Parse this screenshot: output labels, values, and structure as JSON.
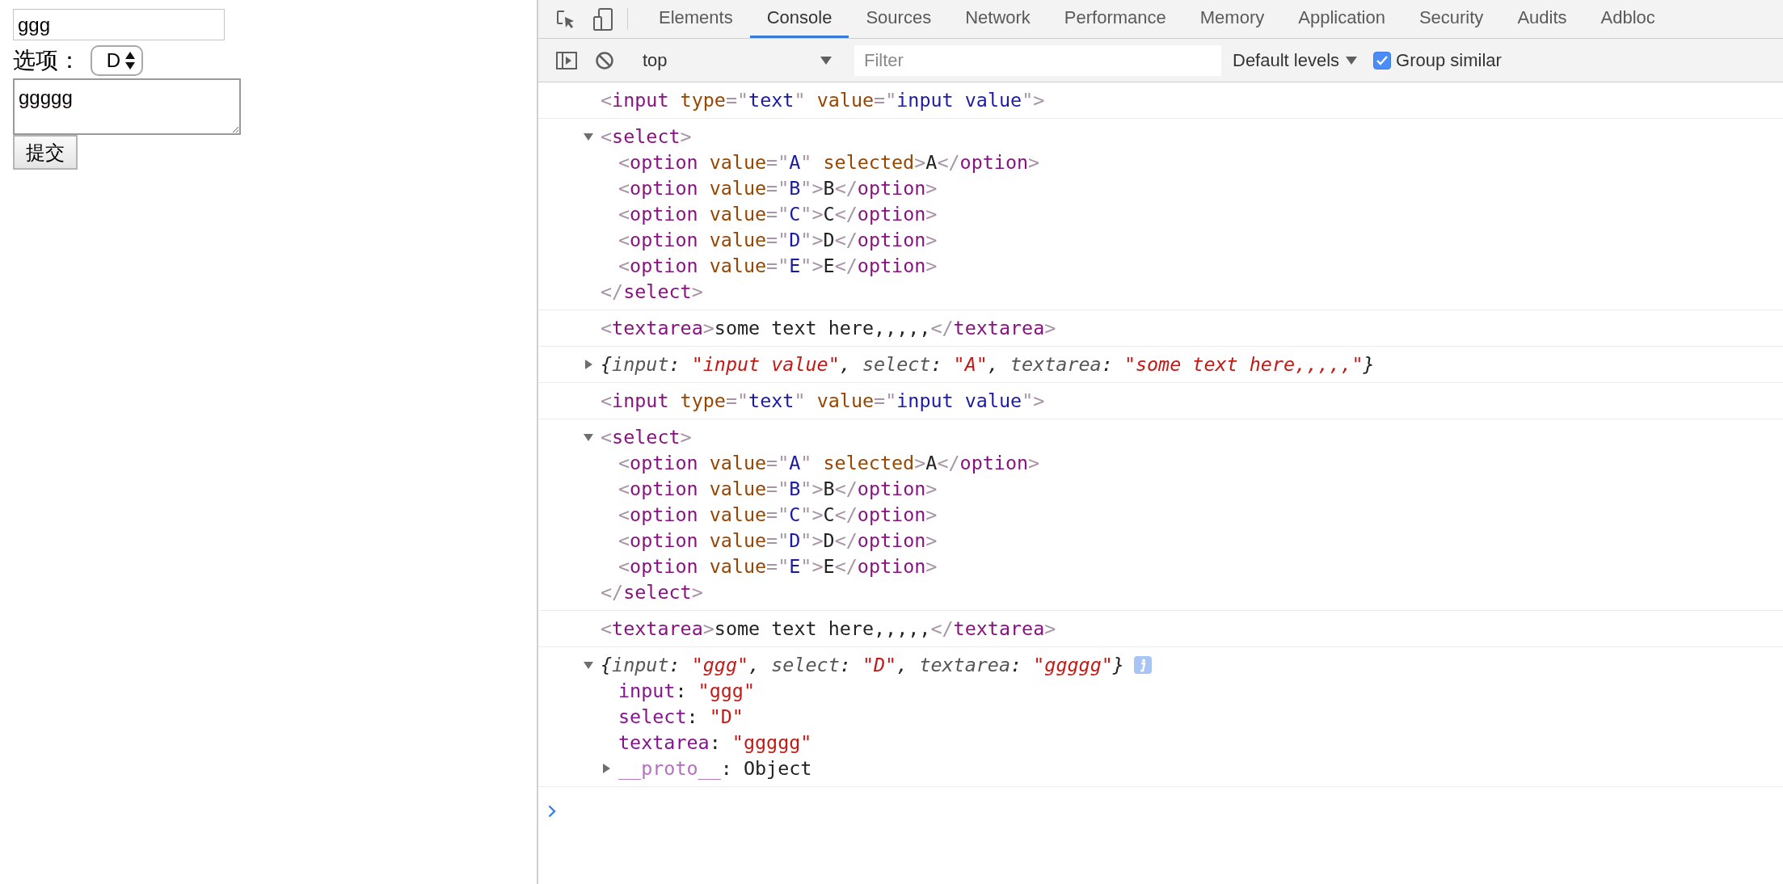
{
  "page_form": {
    "input_value": "ggg",
    "select_label": "选项：",
    "select_value": "D",
    "textarea_value": "ggggg",
    "submit_label": "提交"
  },
  "devtools": {
    "tabs": [
      {
        "label": "Elements",
        "selected": false
      },
      {
        "label": "Console",
        "selected": true
      },
      {
        "label": "Sources",
        "selected": false
      },
      {
        "label": "Network",
        "selected": false
      },
      {
        "label": "Performance",
        "selected": false
      },
      {
        "label": "Memory",
        "selected": false
      },
      {
        "label": "Application",
        "selected": false
      },
      {
        "label": "Security",
        "selected": false
      },
      {
        "label": "Audits",
        "selected": false
      },
      {
        "label": "Adbloc",
        "selected": false
      }
    ],
    "console_toolbar": {
      "context": "top",
      "filter_placeholder": "Filter",
      "levels": "Default levels",
      "group_similar": {
        "label": "Group similar",
        "checked": true
      }
    },
    "messages": [
      {
        "line": [
          {
            "kind": "punct",
            "text": "<"
          },
          {
            "kind": "tag",
            "text": "input"
          },
          {
            "kind": "attr",
            "text": " type"
          },
          {
            "kind": "punct",
            "text": "=\""
          },
          {
            "kind": "value",
            "text": "text"
          },
          {
            "kind": "punct",
            "text": "\""
          },
          {
            "kind": "attr",
            "text": " value"
          },
          {
            "kind": "punct",
            "text": "=\""
          },
          {
            "kind": "value",
            "text": "input value"
          },
          {
            "kind": "punct",
            "text": "\">"
          }
        ]
      },
      {
        "expanded": true,
        "line": [
          {
            "kind": "punct",
            "text": "<"
          },
          {
            "kind": "tag",
            "text": "select"
          },
          {
            "kind": "punct",
            "text": ">"
          }
        ],
        "children": [
          {
            "line": [
              {
                "kind": "punct",
                "text": "<"
              },
              {
                "kind": "tag",
                "text": "option"
              },
              {
                "kind": "attr",
                "text": " value"
              },
              {
                "kind": "punct",
                "text": "=\""
              },
              {
                "kind": "value",
                "text": "A"
              },
              {
                "kind": "punct",
                "text": "\""
              },
              {
                "kind": "attr",
                "text": " selected"
              },
              {
                "kind": "punct",
                "text": ">"
              },
              {
                "kind": "plain",
                "text": "A"
              },
              {
                "kind": "punct",
                "text": "</"
              },
              {
                "kind": "tag",
                "text": "option"
              },
              {
                "kind": "punct",
                "text": ">"
              }
            ]
          },
          {
            "line": [
              {
                "kind": "punct",
                "text": "<"
              },
              {
                "kind": "tag",
                "text": "option"
              },
              {
                "kind": "attr",
                "text": " value"
              },
              {
                "kind": "punct",
                "text": "=\""
              },
              {
                "kind": "value",
                "text": "B"
              },
              {
                "kind": "punct",
                "text": "\">"
              },
              {
                "kind": "plain",
                "text": "B"
              },
              {
                "kind": "punct",
                "text": "</"
              },
              {
                "kind": "tag",
                "text": "option"
              },
              {
                "kind": "punct",
                "text": ">"
              }
            ]
          },
          {
            "line": [
              {
                "kind": "punct",
                "text": "<"
              },
              {
                "kind": "tag",
                "text": "option"
              },
              {
                "kind": "attr",
                "text": " value"
              },
              {
                "kind": "punct",
                "text": "=\""
              },
              {
                "kind": "value",
                "text": "C"
              },
              {
                "kind": "punct",
                "text": "\">"
              },
              {
                "kind": "plain",
                "text": "C"
              },
              {
                "kind": "punct",
                "text": "</"
              },
              {
                "kind": "tag",
                "text": "option"
              },
              {
                "kind": "punct",
                "text": ">"
              }
            ]
          },
          {
            "line": [
              {
                "kind": "punct",
                "text": "<"
              },
              {
                "kind": "tag",
                "text": "option"
              },
              {
                "kind": "attr",
                "text": " value"
              },
              {
                "kind": "punct",
                "text": "=\""
              },
              {
                "kind": "value",
                "text": "D"
              },
              {
                "kind": "punct",
                "text": "\">"
              },
              {
                "kind": "plain",
                "text": "D"
              },
              {
                "kind": "punct",
                "text": "</"
              },
              {
                "kind": "tag",
                "text": "option"
              },
              {
                "kind": "punct",
                "text": ">"
              }
            ]
          },
          {
            "line": [
              {
                "kind": "punct",
                "text": "<"
              },
              {
                "kind": "tag",
                "text": "option"
              },
              {
                "kind": "attr",
                "text": " value"
              },
              {
                "kind": "punct",
                "text": "=\""
              },
              {
                "kind": "value",
                "text": "E"
              },
              {
                "kind": "punct",
                "text": "\">"
              },
              {
                "kind": "plain",
                "text": "E"
              },
              {
                "kind": "punct",
                "text": "</"
              },
              {
                "kind": "tag",
                "text": "option"
              },
              {
                "kind": "punct",
                "text": ">"
              }
            ]
          }
        ],
        "closing": [
          {
            "kind": "punct",
            "text": "</"
          },
          {
            "kind": "tag",
            "text": "select"
          },
          {
            "kind": "punct",
            "text": ">"
          }
        ]
      },
      {
        "line": [
          {
            "kind": "punct",
            "text": "<"
          },
          {
            "kind": "tag",
            "text": "textarea"
          },
          {
            "kind": "punct",
            "text": ">"
          },
          {
            "kind": "plain",
            "text": "some text here,,,,,"
          },
          {
            "kind": "punct",
            "text": "</"
          },
          {
            "kind": "tag",
            "text": "textarea"
          },
          {
            "kind": "punct",
            "text": ">"
          }
        ]
      },
      {
        "expanded": false,
        "line": [
          {
            "kind": "obj_punct",
            "text": "{"
          },
          {
            "kind": "obj_key",
            "text": "input"
          },
          {
            "kind": "obj_punct",
            "text": ": "
          },
          {
            "kind": "obj_string",
            "text": "\"input value\""
          },
          {
            "kind": "obj_punct",
            "text": ", "
          },
          {
            "kind": "obj_key",
            "text": "select"
          },
          {
            "kind": "obj_punct",
            "text": ": "
          },
          {
            "kind": "obj_string",
            "text": "\"A\""
          },
          {
            "kind": "obj_punct",
            "text": ", "
          },
          {
            "kind": "obj_key",
            "text": "textarea"
          },
          {
            "kind": "obj_punct",
            "text": ": "
          },
          {
            "kind": "obj_string",
            "text": "\"some text here,,,,,\""
          },
          {
            "kind": "obj_punct",
            "text": "}"
          }
        ]
      },
      {
        "line": [
          {
            "kind": "punct",
            "text": "<"
          },
          {
            "kind": "tag",
            "text": "input"
          },
          {
            "kind": "attr",
            "text": " type"
          },
          {
            "kind": "punct",
            "text": "=\""
          },
          {
            "kind": "value",
            "text": "text"
          },
          {
            "kind": "punct",
            "text": "\""
          },
          {
            "kind": "attr",
            "text": " value"
          },
          {
            "kind": "punct",
            "text": "=\""
          },
          {
            "kind": "value",
            "text": "input value"
          },
          {
            "kind": "punct",
            "text": "\">"
          }
        ]
      },
      {
        "expanded": true,
        "line": [
          {
            "kind": "punct",
            "text": "<"
          },
          {
            "kind": "tag",
            "text": "select"
          },
          {
            "kind": "punct",
            "text": ">"
          }
        ],
        "children": [
          {
            "line": [
              {
                "kind": "punct",
                "text": "<"
              },
              {
                "kind": "tag",
                "text": "option"
              },
              {
                "kind": "attr",
                "text": " value"
              },
              {
                "kind": "punct",
                "text": "=\""
              },
              {
                "kind": "value",
                "text": "A"
              },
              {
                "kind": "punct",
                "text": "\""
              },
              {
                "kind": "attr",
                "text": " selected"
              },
              {
                "kind": "punct",
                "text": ">"
              },
              {
                "kind": "plain",
                "text": "A"
              },
              {
                "kind": "punct",
                "text": "</"
              },
              {
                "kind": "tag",
                "text": "option"
              },
              {
                "kind": "punct",
                "text": ">"
              }
            ]
          },
          {
            "line": [
              {
                "kind": "punct",
                "text": "<"
              },
              {
                "kind": "tag",
                "text": "option"
              },
              {
                "kind": "attr",
                "text": " value"
              },
              {
                "kind": "punct",
                "text": "=\""
              },
              {
                "kind": "value",
                "text": "B"
              },
              {
                "kind": "punct",
                "text": "\">"
              },
              {
                "kind": "plain",
                "text": "B"
              },
              {
                "kind": "punct",
                "text": "</"
              },
              {
                "kind": "tag",
                "text": "option"
              },
              {
                "kind": "punct",
                "text": ">"
              }
            ]
          },
          {
            "line": [
              {
                "kind": "punct",
                "text": "<"
              },
              {
                "kind": "tag",
                "text": "option"
              },
              {
                "kind": "attr",
                "text": " value"
              },
              {
                "kind": "punct",
                "text": "=\""
              },
              {
                "kind": "value",
                "text": "C"
              },
              {
                "kind": "punct",
                "text": "\">"
              },
              {
                "kind": "plain",
                "text": "C"
              },
              {
                "kind": "punct",
                "text": "</"
              },
              {
                "kind": "tag",
                "text": "option"
              },
              {
                "kind": "punct",
                "text": ">"
              }
            ]
          },
          {
            "line": [
              {
                "kind": "punct",
                "text": "<"
              },
              {
                "kind": "tag",
                "text": "option"
              },
              {
                "kind": "attr",
                "text": " value"
              },
              {
                "kind": "punct",
                "text": "=\""
              },
              {
                "kind": "value",
                "text": "D"
              },
              {
                "kind": "punct",
                "text": "\">"
              },
              {
                "kind": "plain",
                "text": "D"
              },
              {
                "kind": "punct",
                "text": "</"
              },
              {
                "kind": "tag",
                "text": "option"
              },
              {
                "kind": "punct",
                "text": ">"
              }
            ]
          },
          {
            "line": [
              {
                "kind": "punct",
                "text": "<"
              },
              {
                "kind": "tag",
                "text": "option"
              },
              {
                "kind": "attr",
                "text": " value"
              },
              {
                "kind": "punct",
                "text": "=\""
              },
              {
                "kind": "value",
                "text": "E"
              },
              {
                "kind": "punct",
                "text": "\">"
              },
              {
                "kind": "plain",
                "text": "E"
              },
              {
                "kind": "punct",
                "text": "</"
              },
              {
                "kind": "tag",
                "text": "option"
              },
              {
                "kind": "punct",
                "text": ">"
              }
            ]
          }
        ],
        "closing": [
          {
            "kind": "punct",
            "text": "</"
          },
          {
            "kind": "tag",
            "text": "select"
          },
          {
            "kind": "punct",
            "text": ">"
          }
        ]
      },
      {
        "line": [
          {
            "kind": "punct",
            "text": "<"
          },
          {
            "kind": "tag",
            "text": "textarea"
          },
          {
            "kind": "punct",
            "text": ">"
          },
          {
            "kind": "plain",
            "text": "some text here,,,,,"
          },
          {
            "kind": "punct",
            "text": "</"
          },
          {
            "kind": "tag",
            "text": "textarea"
          },
          {
            "kind": "punct",
            "text": ">"
          }
        ]
      },
      {
        "expanded": true,
        "info": true,
        "line": [
          {
            "kind": "obj_punct",
            "text": "{"
          },
          {
            "kind": "obj_key",
            "text": "input"
          },
          {
            "kind": "obj_punct",
            "text": ": "
          },
          {
            "kind": "obj_string",
            "text": "\"ggg\""
          },
          {
            "kind": "obj_punct",
            "text": ", "
          },
          {
            "kind": "obj_key",
            "text": "select"
          },
          {
            "kind": "obj_punct",
            "text": ": "
          },
          {
            "kind": "obj_string",
            "text": "\"D\""
          },
          {
            "kind": "obj_punct",
            "text": ", "
          },
          {
            "kind": "obj_key",
            "text": "textarea"
          },
          {
            "kind": "obj_punct",
            "text": ": "
          },
          {
            "kind": "obj_string",
            "text": "\"ggggg\""
          },
          {
            "kind": "obj_punct",
            "text": "}"
          }
        ],
        "children": [
          {
            "line": [
              {
                "kind": "prop_key",
                "text": "input"
              },
              {
                "kind": "plain",
                "text": ": "
              },
              {
                "kind": "prop_string",
                "text": "\"ggg\""
              }
            ]
          },
          {
            "line": [
              {
                "kind": "prop_key",
                "text": "select"
              },
              {
                "kind": "plain",
                "text": ": "
              },
              {
                "kind": "prop_string",
                "text": "\"D\""
              }
            ]
          },
          {
            "line": [
              {
                "kind": "prop_key",
                "text": "textarea"
              },
              {
                "kind": "plain",
                "text": ": "
              },
              {
                "kind": "prop_string",
                "text": "\"ggggg\""
              }
            ]
          },
          {
            "expanded": false,
            "line": [
              {
                "kind": "proto_key",
                "text": "__proto__"
              },
              {
                "kind": "plain",
                "text": ": Object"
              }
            ]
          }
        ]
      }
    ]
  }
}
